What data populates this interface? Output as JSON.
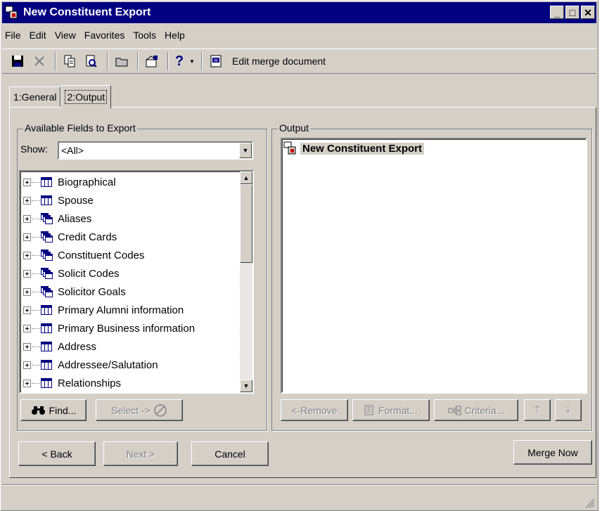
{
  "window": {
    "title": "New Constituent Export"
  },
  "menu": [
    "File",
    "Edit",
    "View",
    "Favorites",
    "Tools",
    "Help"
  ],
  "toolbar": {
    "icons": [
      "save-icon",
      "delete-icon",
      "copy-icon",
      "print-preview-icon",
      "open-folder-icon",
      "properties-icon",
      "help-icon",
      "dropdown-arrow-icon",
      "word-document-icon"
    ],
    "merge_label": "Edit merge document"
  },
  "tabs": [
    {
      "label": "1:General",
      "active": false
    },
    {
      "label": "2:Output",
      "active": true
    }
  ],
  "available": {
    "group_label": "Available Fields to Export",
    "show_label": "Show:",
    "show_value": "<All>",
    "fields": [
      {
        "label": "Biographical",
        "icon": "table"
      },
      {
        "label": "Spouse",
        "icon": "table"
      },
      {
        "label": "Aliases",
        "icon": "multi-table"
      },
      {
        "label": "Credit Cards",
        "icon": "multi-table"
      },
      {
        "label": "Constituent Codes",
        "icon": "multi-table"
      },
      {
        "label": "Solicit Codes",
        "icon": "multi-table"
      },
      {
        "label": "Solicitor Goals",
        "icon": "multi-table"
      },
      {
        "label": "Primary Alumni information",
        "icon": "table"
      },
      {
        "label": "Primary Business information",
        "icon": "table"
      },
      {
        "label": "Address",
        "icon": "table"
      },
      {
        "label": "Addressee/Salutation",
        "icon": "table"
      },
      {
        "label": "Relationships",
        "icon": "table"
      }
    ],
    "find_label": "Find...",
    "select_label": "Select ->"
  },
  "output": {
    "group_label": "Output",
    "root_label": "New Constituent Export",
    "remove_label": "<-Remove",
    "format_label": "Format...",
    "criteria_label": "Criteria..."
  },
  "nav": {
    "back_label": "< Back",
    "next_label": "Next >",
    "cancel_label": "Cancel",
    "merge_label": "Merge Now"
  },
  "colors": {
    "titlebar": "#000080",
    "face": "#d4d0c8",
    "selection": "#d4d0c8"
  }
}
